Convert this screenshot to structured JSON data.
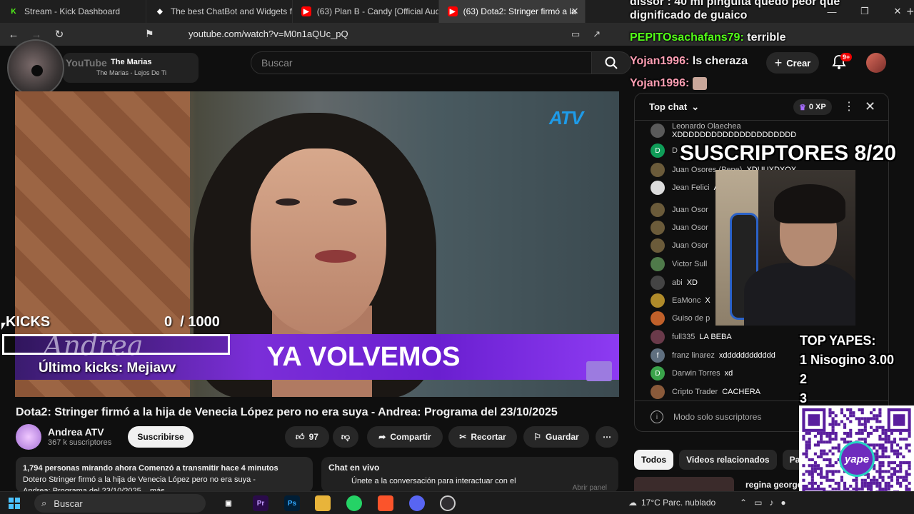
{
  "browser": {
    "tabs": [
      {
        "title": "Stream - Kick Dashboard",
        "fav_color": "#53fc18",
        "fav_glyph": "K"
      },
      {
        "title": "The best ChatBot and Widgets for Ki",
        "fav_color": "#ffffff",
        "fav_glyph": "◆"
      },
      {
        "title": "(63) Plan B - Candy [Official Audio] -",
        "fav_color": "#ff0000",
        "fav_glyph": "▶"
      },
      {
        "title": "(63) Dota2: Stringer firmó a la",
        "fav_color": "#ff0000",
        "fav_glyph": "▶"
      }
    ],
    "new_tab": "+",
    "url": "youtube.com/watch?v=M0n1aQUc_pQ"
  },
  "youtube": {
    "logo": "YouTube",
    "mini_player": {
      "title": "The Marias",
      "subtitle": "The Marias - Lejos De Ti"
    },
    "search_placeholder": "Buscar",
    "create_label": "Crear",
    "notif_count": "9+",
    "video_overlay": {
      "brand": "ATV",
      "banner_text": "YA VOLVEMOS",
      "banner_logo": "Andrea"
    },
    "video_title": "Dota2: Stringer firmó a la hija de Venecia López pero no era suya - Andrea: Programa del 23/10/2025",
    "channel": {
      "name": "Andrea ATV",
      "subs": "367 k suscriptores",
      "subscribe_label": "Suscribirse"
    },
    "actions": {
      "likes": "97",
      "share": "Compartir",
      "clip": "Recortar",
      "save": "Guardar"
    },
    "description": {
      "stats": "1,794 personas mirando ahora  Comenzó a transmitir hace 4 minutos",
      "line2": "Dotero Stringer firmó a la hija de Venecia López pero no era suya -",
      "line3": "Andrea: Programa del 23/10/2025 ...más"
    },
    "chat_embed": {
      "title": "Chat en vivo",
      "text": "Únete a la conversación para interactuar con el",
      "open_label": "Abrir panel"
    },
    "chat": {
      "mode": "Top chat",
      "xp": "0 XP",
      "messages": [
        {
          "author": "Leonardo Olaechea",
          "text": "XDDDDDDDDDDDDDDDDDDDDD",
          "color": "#5a5a5a",
          "initial": ""
        },
        {
          "author": "D",
          "text": "",
          "color": "#0f9d58",
          "initial": "D"
        },
        {
          "author": "Juan Osores (Pepe)",
          "text": "XDUUXDXOX",
          "color": "#6b5b3a",
          "initial": ""
        },
        {
          "author": "Jean Felici",
          "text": "A LAS PER",
          "color": "#ddd",
          "initial": ""
        },
        {
          "author": "Juan Osor",
          "text": "",
          "color": "#6b5b3a",
          "initial": ""
        },
        {
          "author": "Juan Osor",
          "text": "",
          "color": "#6b5b3a",
          "initial": ""
        },
        {
          "author": "Juan Osor",
          "text": "",
          "color": "#6b5b3a",
          "initial": ""
        },
        {
          "author": "Victor Sull",
          "text": "",
          "color": "#4f7a4a",
          "initial": ""
        },
        {
          "author": "abi",
          "text": "XD",
          "color": "#444",
          "initial": ""
        },
        {
          "author": "EaMonc",
          "text": "X",
          "color": "#b08b2a",
          "initial": ""
        },
        {
          "author": "Guiso de p",
          "text": "",
          "color": "#c0602a",
          "initial": ""
        },
        {
          "author": "full335",
          "text": "LA BEBA",
          "color": "#6a3a4a",
          "initial": ""
        },
        {
          "author": "franz linarez",
          "text": "xdddddddddddd",
          "color": "#5f6f7f",
          "initial": "f"
        },
        {
          "author": "Darwin Torres",
          "text": "xd",
          "color": "#3aa34a",
          "initial": "D"
        },
        {
          "author": "Cripto Trader",
          "text": "CACHERA",
          "color": "#8a5a3a",
          "initial": ""
        }
      ],
      "footer": "Modo solo suscriptores"
    },
    "chips": [
      "Todos",
      "Videos relacionados",
      "Pa"
    ],
    "related_title": "regina george"
  },
  "stream_overlay": {
    "top_lines": [
      {
        "user": "",
        "text": "dissor : 40 mi pinguita quedo peor que",
        "color": "#ffffff"
      },
      {
        "user": "",
        "text": "dignificado de guaico",
        "color": "#ffffff"
      },
      {
        "user": "PEPITOsachafans79:",
        "text": "terrible",
        "color": "#53fc18"
      },
      {
        "user": "Yojan1996:",
        "text": "ls cheraza",
        "color": "#ff9fb4"
      },
      {
        "user": "Yojan1996:",
        "text": "",
        "color": "#ff9fb4"
      }
    ],
    "subs_goal": "SUSCRIPTORES 8/20",
    "kicks_label": "KICKS",
    "kicks_count": "0",
    "kicks_goal": "/ 1000",
    "kicks_progress": 0,
    "last_kicks": "Último kicks: Mejiavv",
    "top_yapes_title": "TOP YAPES:",
    "top_yapes": [
      "1 Nisogino 3.00",
      "2",
      "3"
    ],
    "qr_label": "yape"
  },
  "taskbar": {
    "search": "Buscar",
    "weather": "17°C  Parc. nublado",
    "apps": [
      "Pr",
      "Ps",
      "📁",
      "WA",
      "Brave",
      "Discord",
      "OBS"
    ]
  },
  "colors": {
    "yt_red": "#ff0000",
    "kick_green": "#53fc18",
    "banner_purple": "#7b2ed8",
    "atv_blue": "#1e9be8"
  }
}
